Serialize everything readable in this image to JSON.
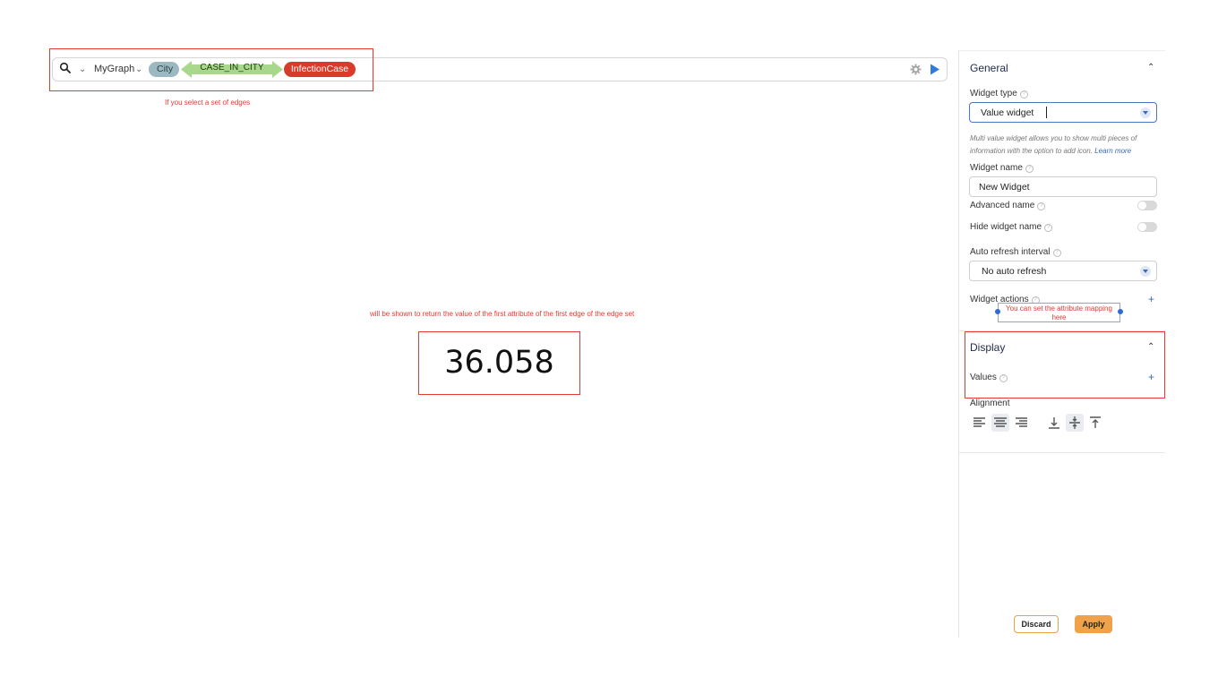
{
  "query": {
    "graph_name": "MyGraph",
    "source_vertex": "City",
    "edge": "CASE_IN_CITY",
    "target_vertex": "InfectionCase",
    "icons": {
      "search": "search-icon",
      "chevron": "chevron-down-icon",
      "settings": "gear-icon",
      "run": "play-icon"
    },
    "colors": {
      "city_pill": "#9cb9c1",
      "edge_arrow": "#a9d78c",
      "infection_pill": "#d83a2b",
      "run_icon": "#2f7be0"
    }
  },
  "annotations": {
    "edges_note": "If you select a set of edges",
    "value_note": "will be shown to return the value of the first attribute of the first edge of the edge set",
    "mapping_note_line1": "You can set the attribute mapping",
    "mapping_note_line2": "here",
    "highlight_color": "#e03c31"
  },
  "widget": {
    "value": "36.058"
  },
  "panel": {
    "general": {
      "title": "General",
      "widget_type_label": "Widget type",
      "widget_type_value": "Value widget",
      "description": "Multi value widget allows you to show multi pieces of information with the option to add icon.",
      "learn_more": "Learn more",
      "widget_name_label": "Widget name",
      "widget_name_value": "New Widget",
      "advanced_name_label": "Advanced name",
      "hide_widget_name_label": "Hide widget name",
      "auto_refresh_label": "Auto refresh interval",
      "auto_refresh_value": "No auto refresh",
      "widget_actions_label": "Widget actions"
    },
    "display": {
      "title": "Display",
      "values_label": "Values",
      "alignment_label": "Alignment"
    },
    "buttons": {
      "discard": "Discard",
      "apply": "Apply"
    },
    "accent_color": "#f0a24b"
  }
}
